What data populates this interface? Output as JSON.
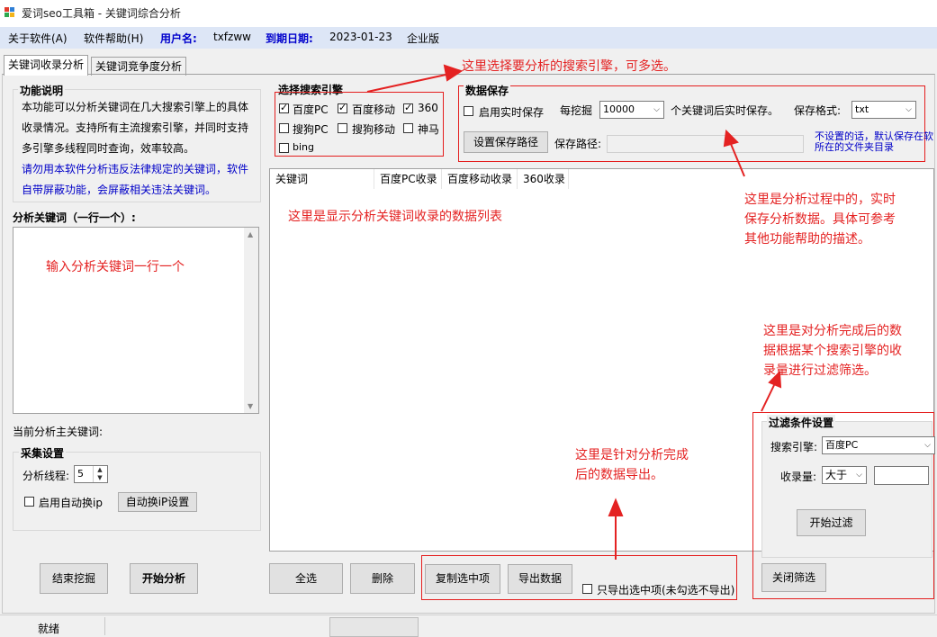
{
  "window": {
    "title": "爱词seo工具箱 - 关键词综合分析"
  },
  "menu": {
    "about": "关于软件(A)",
    "help": "软件帮助(H)",
    "username_label": "用户名:",
    "username": "txfzww",
    "expiry_label": "到期日期:",
    "expiry": "2023-01-23",
    "edition": "企业版"
  },
  "tabs": [
    "关键词收录分析",
    "关键词竞争度分析"
  ],
  "info": {
    "title": "功能说明",
    "text1": [
      "本功能可以分析关键词在几大搜索引擎上的具体",
      "收录情况。支持所有主流搜索引擎，并同时支持",
      "多引擎多线程同时查询，效率较高。"
    ],
    "text2": [
      "请勿用本软件分析违反法律规定的关键词，软件",
      "自带屏蔽功能，会屏蔽相关违法关键词。"
    ]
  },
  "keywords": {
    "label": "分析关键词（一行一个）:",
    "current_label": "当前分析主关键词:"
  },
  "collect": {
    "title": "采集设置",
    "threads_label": "分析线程:",
    "threads": "5",
    "auto_ip_label": "启用自动换ip",
    "auto_ip_btn": "自动换iP设置"
  },
  "engines": {
    "title": "选择搜索引擎",
    "items": [
      {
        "label": "百度PC",
        "checked": true
      },
      {
        "label": "百度移动",
        "checked": true
      },
      {
        "label": "360",
        "checked": true
      },
      {
        "label": "搜狗PC",
        "checked": false
      },
      {
        "label": "搜狗移动",
        "checked": false
      },
      {
        "label": "神马",
        "checked": false
      },
      {
        "label": "bing",
        "checked": false
      }
    ]
  },
  "save": {
    "title": "数据保存",
    "realtime_label": "启用实时保存",
    "per_label": "每挖掘",
    "per_value": "10000",
    "per_suffix": "个关键词后实时保存。",
    "format_label": "保存格式:",
    "format_value": "txt",
    "path_btn": "设置保存路径",
    "path_label": "保存路径:",
    "path_value": "",
    "note1": "不设置的话，默认保存在软",
    "note2": "所在的文件夹目录"
  },
  "table": {
    "columns": [
      "关键词",
      "百度PC收录",
      "百度移动收录",
      "360收录"
    ]
  },
  "filter": {
    "title": "过滤条件设置",
    "engine_label": "搜索引擎:",
    "engine_value": "百度PC",
    "count_label": "收录量:",
    "op_value": "大于",
    "count_value": "",
    "start_btn": "开始过滤",
    "close_btn": "关闭筛选"
  },
  "buttons": {
    "stop": "结束挖掘",
    "start": "开始分析",
    "select_all": "全选",
    "delete": "删除",
    "copy_selected": "复制选中项",
    "export": "导出数据",
    "export_selected_only": "只导出选中项(未勾选不导出)"
  },
  "status": {
    "ready": "就绪"
  },
  "annotations": {
    "engines": "这里选择要分析的搜索引擎，可多选。",
    "realtime": [
      "这里是分析过程中的，实时",
      "保存分析数据。具体可参考",
      "其他功能帮助的描述。"
    ],
    "list": "这里是显示分析关键词收录的数据列表",
    "input": "输入分析关键词一行一个",
    "filter": [
      "这里是对分析完成后的数",
      "据根据某个搜索引擎的收",
      "录量进行过滤筛选。"
    ],
    "export": [
      "这里是针对分析完成",
      "后的数据导出。"
    ]
  },
  "colors": {
    "annotation": "#e42222",
    "menu_bold": "#0000cc",
    "info_blue": "#0000c8"
  }
}
